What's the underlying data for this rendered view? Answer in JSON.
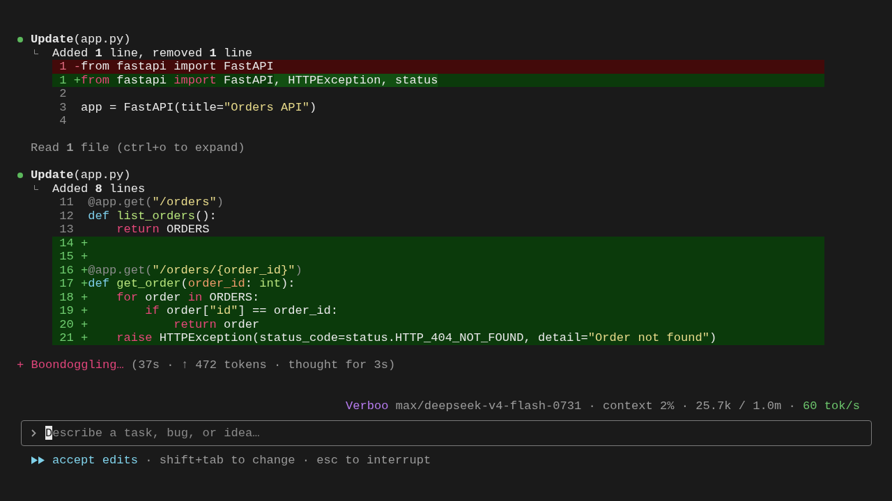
{
  "transcript": [
    {
      "kind": "tool",
      "title": "**Update**(app.py)",
      "summary": "Added **1** line, removed **1** line",
      "diff": [
        {
          "number": "1",
          "kind": "removed",
          "sign": "-",
          "code": [
            {
              "text": "from fastapi import FastAPI",
              "kind": "plain"
            }
          ]
        },
        {
          "number": "1",
          "kind": "added",
          "sign": "+",
          "code": [
            {
              "text": "from",
              "kind": "keyword"
            },
            {
              "text": " fastapi ",
              "kind": "plain"
            },
            {
              "text": "import",
              "kind": "keyword"
            },
            {
              "text": " FastAPI",
              "kind": "plain"
            },
            {
              "text": ", HTTPException, status",
              "kind": "inserted"
            }
          ]
        },
        {
          "number": "2",
          "kind": "context"
        },
        {
          "number": "3",
          "kind": "context",
          "code": [
            {
              "text": "app = FastAPI(title=",
              "kind": "plain"
            },
            {
              "text": "\"Orders API\"",
              "kind": "string"
            },
            {
              "text": ")",
              "kind": "plain"
            }
          ]
        },
        {
          "number": "4",
          "kind": "context"
        }
      ]
    },
    {
      "kind": "note",
      "text": "Read **1** file (ctrl+o to expand)"
    },
    {
      "kind": "tool",
      "title": "**Update**(app.py)",
      "summary": "Added **8** lines",
      "diff": [
        {
          "number": "11",
          "kind": "context",
          "code": [
            {
              "text": "@app.get(",
              "kind": "decorator"
            },
            {
              "text": "\"/orders\"",
              "kind": "string"
            },
            {
              "text": ")",
              "kind": "decorator"
            }
          ]
        },
        {
          "number": "12",
          "kind": "context",
          "code": [
            {
              "text": "def",
              "kind": "def"
            },
            {
              "text": " list_orders",
              "kind": "func"
            },
            {
              "text": "():",
              "kind": "plain"
            }
          ]
        },
        {
          "number": "13",
          "kind": "context",
          "code": [
            {
              "text": "    return",
              "kind": "keyword"
            },
            {
              "text": " ORDERS",
              "kind": "plain"
            }
          ]
        },
        {
          "number": "14",
          "kind": "added",
          "sign": "+"
        },
        {
          "number": "15",
          "kind": "added",
          "sign": "+"
        },
        {
          "number": "16",
          "kind": "added",
          "sign": "+",
          "code": [
            {
              "text": "@app.get(",
              "kind": "decorator"
            },
            {
              "text": "\"/orders/{order_id}\"",
              "kind": "string"
            },
            {
              "text": ")",
              "kind": "decorator"
            }
          ]
        },
        {
          "number": "17",
          "kind": "added",
          "sign": "+",
          "code": [
            {
              "text": "def",
              "kind": "def"
            },
            {
              "text": " get_order",
              "kind": "func"
            },
            {
              "text": "(",
              "kind": "plain"
            },
            {
              "text": "order_id",
              "kind": "param"
            },
            {
              "text": ": ",
              "kind": "plain"
            },
            {
              "text": "int",
              "kind": "type"
            },
            {
              "text": "):",
              "kind": "plain"
            }
          ]
        },
        {
          "number": "18",
          "kind": "added",
          "sign": "+",
          "code": [
            {
              "text": "    for",
              "kind": "keyword"
            },
            {
              "text": " order ",
              "kind": "plain"
            },
            {
              "text": "in",
              "kind": "keyword"
            },
            {
              "text": " ORDERS:",
              "kind": "plain"
            }
          ]
        },
        {
          "number": "19",
          "kind": "added",
          "sign": "+",
          "code": [
            {
              "text": "        if",
              "kind": "keyword"
            },
            {
              "text": " order[",
              "kind": "plain"
            },
            {
              "text": "\"id\"",
              "kind": "string"
            },
            {
              "text": "] == order_id:",
              "kind": "plain"
            }
          ]
        },
        {
          "number": "20",
          "kind": "added",
          "sign": "+",
          "code": [
            {
              "text": "            return",
              "kind": "keyword"
            },
            {
              "text": " order",
              "kind": "plain"
            }
          ]
        },
        {
          "number": "21",
          "kind": "added",
          "sign": "+",
          "code": [
            {
              "text": "    raise",
              "kind": "keyword"
            },
            {
              "text": " HTTPException(status_code=status.HTTP_404_NOT_FOUND, detail=",
              "kind": "plain"
            },
            {
              "text": "\"Order not found\"",
              "kind": "string"
            },
            {
              "text": ")",
              "kind": "plain"
            }
          ]
        }
      ]
    }
  ],
  "spinner": {
    "glyph": "+",
    "label": "Boondoggling…",
    "stats": "(37s · ↑ 472 tokens · thought for 3s)"
  },
  "status_line": {
    "agent": "Verboo",
    "details": "max/deepseek-v4-flash-0731 · context 2% · 25.7k / 1.0m ·",
    "speed": "60 tok/s"
  },
  "input": {
    "placeholder": "Describe a task, bug, or idea…",
    "cursor": true
  },
  "mode": {
    "label": "accept edits",
    "hints": "· shift+tab to change · esc to interrupt"
  }
}
